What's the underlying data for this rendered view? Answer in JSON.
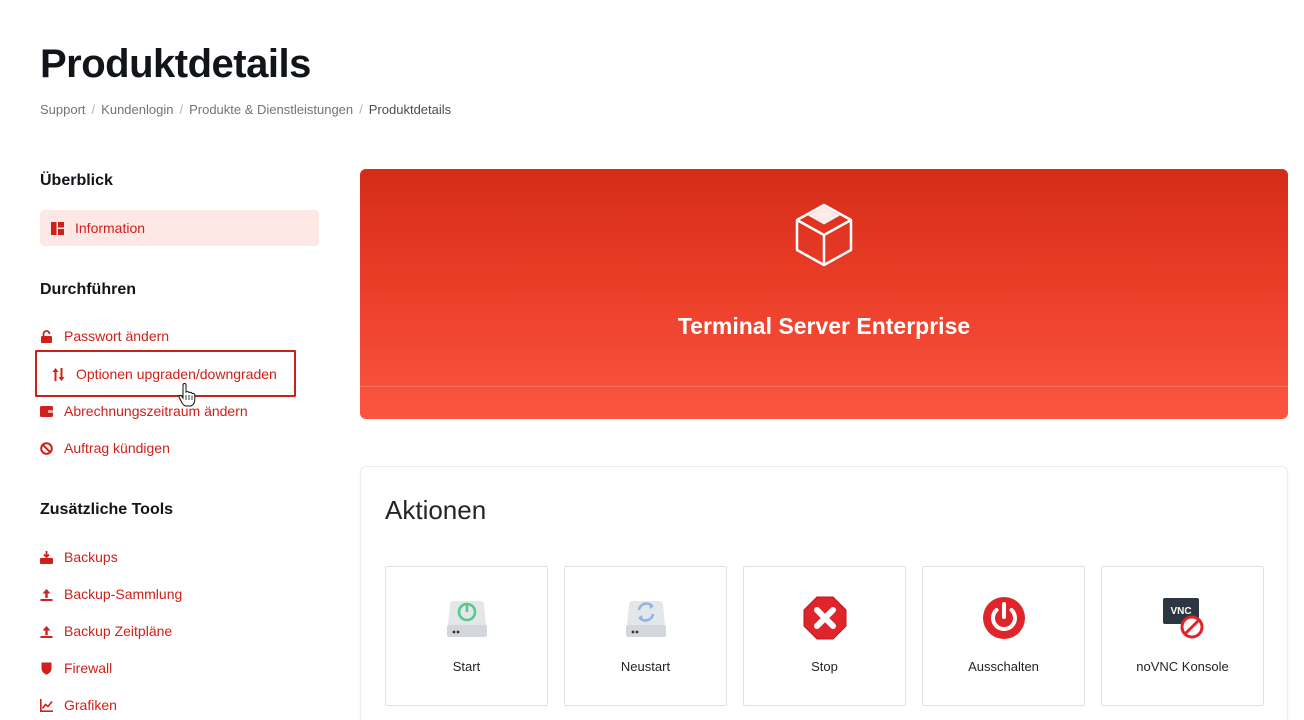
{
  "page": {
    "title": "Produktdetails"
  },
  "breadcrumb": [
    {
      "label": "Support"
    },
    {
      "label": "Kundenlogin"
    },
    {
      "label": "Produkte & Dienstleistungen"
    },
    {
      "label": "Produktdetails"
    }
  ],
  "sidebar": {
    "overview": {
      "heading": "Überblick",
      "items": [
        {
          "label": "Information",
          "icon": "dashboard-icon"
        }
      ]
    },
    "actions": {
      "heading": "Durchführen",
      "items": [
        {
          "label": "Passwort ändern",
          "icon": "lock-icon"
        },
        {
          "label": "Optionen upgraden/downgraden",
          "icon": "up-down-arrows-icon"
        },
        {
          "label": "Abrechnungszeitraum ändern",
          "icon": "wallet-icon"
        },
        {
          "label": "Auftrag kündigen",
          "icon": "ban-icon"
        }
      ]
    },
    "tools": {
      "heading": "Zusätzliche Tools",
      "items": [
        {
          "label": "Backups",
          "icon": "inbox-download-icon"
        },
        {
          "label": "Backup-Sammlung",
          "icon": "upload-icon"
        },
        {
          "label": "Backup Zeitpläne",
          "icon": "upload-icon"
        },
        {
          "label": "Firewall",
          "icon": "shield-icon"
        },
        {
          "label": "Grafiken",
          "icon": "line-chart-icon"
        }
      ]
    }
  },
  "product": {
    "name": "Terminal Server Enterprise",
    "icon": "cube-icon"
  },
  "actions_card": {
    "title": "Aktionen",
    "tiles": [
      {
        "label": "Start",
        "icon": "server-power-icon"
      },
      {
        "label": "Neustart",
        "icon": "server-restart-icon"
      },
      {
        "label": "Stop",
        "icon": "stop-octagon-icon"
      },
      {
        "label": "Ausschalten",
        "icon": "power-button-icon"
      },
      {
        "label": "noVNC Konsole",
        "icon": "vnc-console-icon"
      }
    ]
  },
  "colors": {
    "accent": "#d0201a",
    "hero_top": "#d42c18",
    "hero_bottom": "#fb5640",
    "active_bg": "#fde8e6"
  }
}
